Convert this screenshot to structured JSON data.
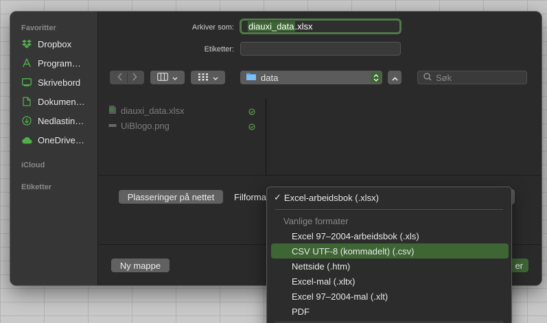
{
  "sidebar": {
    "favorites_header": "Favoritter",
    "items": [
      {
        "label": "Dropbox",
        "icon": "dropbox-icon"
      },
      {
        "label": "Program…",
        "icon": "applications-icon"
      },
      {
        "label": "Skrivebord",
        "icon": "desktop-icon"
      },
      {
        "label": "Dokumen…",
        "icon": "document-icon"
      },
      {
        "label": "Nedlastin…",
        "icon": "download-icon"
      },
      {
        "label": "OneDrive…",
        "icon": "cloud-icon"
      }
    ],
    "icloud_header": "iCloud",
    "tags_header": "Etiketter"
  },
  "form": {
    "save_as_label": "Arkiver som:",
    "filename_base": "diauxi_data",
    "filename_ext": ".xlsx",
    "tags_label": "Etiketter:",
    "tags_value": ""
  },
  "toolbar": {
    "location": "data",
    "search_placeholder": "Søk"
  },
  "files": [
    {
      "name": "diauxi_data.xlsx",
      "icon": "spreadsheet-file-icon"
    },
    {
      "name": "UiBlogo.png",
      "icon": "image-file-icon"
    }
  ],
  "bottom": {
    "online_locations_button": "Plasseringer på nettet",
    "format_label": "Filformat:",
    "new_folder_button": "Ny mappe",
    "save_button_partial": "er"
  },
  "format_menu": {
    "checked_item": "Excel-arbeidsbok (.xlsx)",
    "section_header": "Vanlige formater",
    "items": [
      "Excel 97–2004-arbeidsbok (.xls)",
      "CSV UTF-8 (kommadelt) (.csv)",
      "Nettside (.htm)",
      "Excel-mal (.xltx)",
      "Excel 97–2004-mal (.xlt)",
      "PDF"
    ],
    "selected_index": 1
  },
  "colors": {
    "accent_green": "#3e6634",
    "focus_ring": "#4f7a45",
    "folder_blue": "#4aa3f0",
    "status_green": "#5c9a48"
  }
}
